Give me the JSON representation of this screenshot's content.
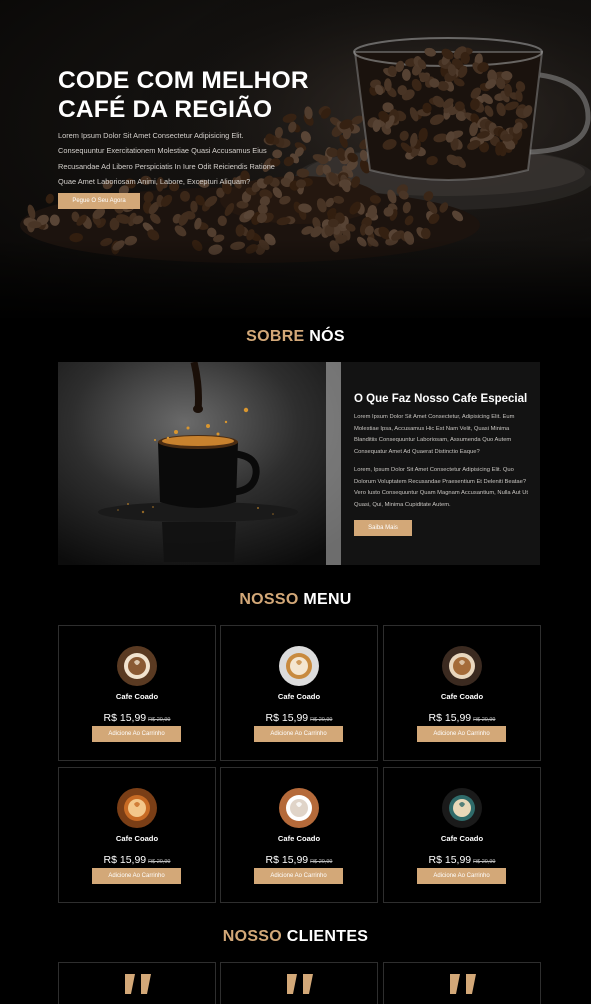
{
  "hero": {
    "title_line1": "CODE COM MELHOR",
    "title_line2": "CAFÉ DA REGIÃO",
    "text": "Lorem Ipsum Dolor Sit Amet Consectetur Adipisicing Elit. Consequuntur Exercitationem Molestiae Quasi Accusamus Eius Recusandae Ad Libero Perspiciatis In Iure Odit Reiciendis Ratione Quae Amet Laboriosam Animi, Labore, Excepturi Aliquam?",
    "button": "Pegue O Seu Agora"
  },
  "about": {
    "title_accent": "SOBRE",
    "title_rest": " NÓS",
    "heading": "O Que Faz Nosso Cafe Especial",
    "paragraph1": "Lorem Ipsum Dolor Sit Amet Consectetur, Adipisicing Elit. Eum Molestiae Ipsa, Accusamus Hic Est Nam Velit, Quasi Minima Blanditiis Consequuntur Laboriosam, Assumenda Quo Autem Consequatur Amet Ad Quaerat Distinctio Eaque?",
    "paragraph2": "Lorem, Ipsum Dolor Sit Amet Consectetur Adipisicing Elit. Quo Dolorum Voluptatem Recusandae Praesentium Et Deleniti Beatae? Vero Iusto Consequuntur Quam Magnam Accusantium, Nulla Aut Ut Quasi, Qui, Minima Cupiditate Autem.",
    "button": "Saiba Mais"
  },
  "menu": {
    "title_accent": "NOSSO",
    "title_rest": " MENU",
    "items": [
      {
        "name": "Cafe Coado",
        "price": "R$ 15,99",
        "old_price": "R$ 20,99",
        "button": "Adicione Ao Carrinho"
      },
      {
        "name": "Cafe Coado",
        "price": "R$ 15,99",
        "old_price": "R$ 20,99",
        "button": "Adicione Ao Carrinho"
      },
      {
        "name": "Cafe Coado",
        "price": "R$ 15,99",
        "old_price": "R$ 20,99",
        "button": "Adicione Ao Carrinho"
      },
      {
        "name": "Cafe Coado",
        "price": "R$ 15,99",
        "old_price": "R$ 20,99",
        "button": "Adicione Ao Carrinho"
      },
      {
        "name": "Cafe Coado",
        "price": "R$ 15,99",
        "old_price": "R$ 20,99",
        "button": "Adicione Ao Carrinho"
      },
      {
        "name": "Cafe Coado",
        "price": "R$ 15,99",
        "old_price": "R$ 20,99",
        "button": "Adicione Ao Carrinho"
      }
    ]
  },
  "clients": {
    "title_accent": "NOSSO",
    "title_rest": " CLIENTES",
    "quote_icon": "quote-icon"
  },
  "colors": {
    "accent": "#d3a878",
    "background": "#000000",
    "panel": "#131313",
    "card_border": "#2e2e2e"
  }
}
